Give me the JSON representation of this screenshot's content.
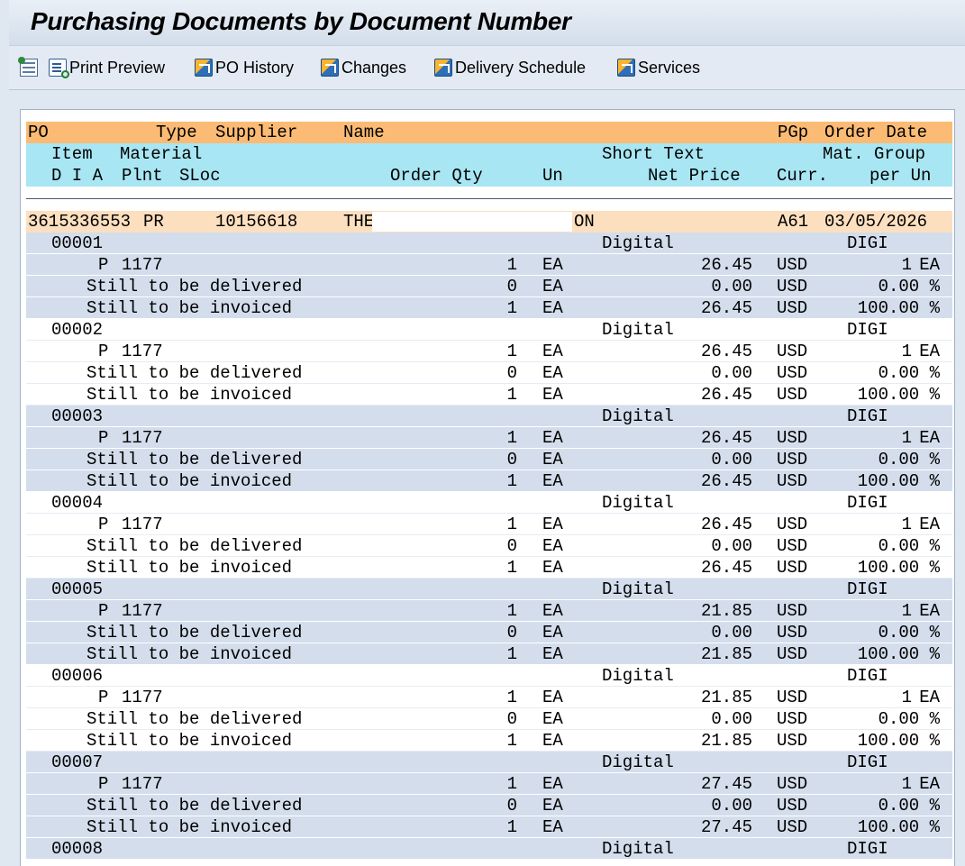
{
  "window": {
    "title": "Purchasing Documents by Document Number"
  },
  "toolbar": {
    "print_preview": "Print Preview",
    "po_history": "PO History",
    "changes": "Changes",
    "delivery_schedule": "Delivery Schedule",
    "services": "Services"
  },
  "headers": {
    "row1": {
      "po": "PO",
      "type": "Type",
      "supplier": "Supplier",
      "name": "Name",
      "pgp": "PGp",
      "order_date": "Order Date"
    },
    "row2": {
      "item": "Item",
      "material": "Material",
      "short_text": "Short Text",
      "mat_group": "Mat. Group"
    },
    "row3": {
      "dia": "D I A",
      "plnt": "Plnt",
      "sloc": "SLoc",
      "order_qty": "Order Qty",
      "un": "Un",
      "net_price": "Net Price",
      "curr": "Curr.",
      "per_un": "per Un"
    }
  },
  "document": {
    "po_number": "3615336553",
    "type": "PR",
    "supplier": "10156618",
    "name_start": "THE",
    "name_end": "ON",
    "pgp": "A61",
    "order_date": "03/05/2026"
  },
  "labels": {
    "delivered": "Still to be delivered",
    "invoiced": "Still to be invoiced"
  },
  "items": [
    {
      "item": "00001",
      "short_text": "Digital",
      "mat_group": "DIGI",
      "a": "P",
      "plant": "1177",
      "qty": "1",
      "un": "EA",
      "price": "26.45",
      "curr": "USD",
      "per": "1",
      "per_un": "EA",
      "del_qty": "0",
      "del_un": "EA",
      "del_price": "0.00",
      "del_curr": "USD",
      "del_pct": "0.00 %",
      "inv_qty": "1",
      "inv_un": "EA",
      "inv_price": "26.45",
      "inv_curr": "USD",
      "inv_pct": "100.00 %"
    },
    {
      "item": "00002",
      "short_text": "Digital",
      "mat_group": "DIGI",
      "a": "P",
      "plant": "1177",
      "qty": "1",
      "un": "EA",
      "price": "26.45",
      "curr": "USD",
      "per": "1",
      "per_un": "EA",
      "del_qty": "0",
      "del_un": "EA",
      "del_price": "0.00",
      "del_curr": "USD",
      "del_pct": "0.00 %",
      "inv_qty": "1",
      "inv_un": "EA",
      "inv_price": "26.45",
      "inv_curr": "USD",
      "inv_pct": "100.00 %"
    },
    {
      "item": "00003",
      "short_text": "Digital",
      "mat_group": "DIGI",
      "a": "P",
      "plant": "1177",
      "qty": "1",
      "un": "EA",
      "price": "26.45",
      "curr": "USD",
      "per": "1",
      "per_un": "EA",
      "del_qty": "0",
      "del_un": "EA",
      "del_price": "0.00",
      "del_curr": "USD",
      "del_pct": "0.00 %",
      "inv_qty": "1",
      "inv_un": "EA",
      "inv_price": "26.45",
      "inv_curr": "USD",
      "inv_pct": "100.00 %"
    },
    {
      "item": "00004",
      "short_text": "Digital",
      "mat_group": "DIGI",
      "a": "P",
      "plant": "1177",
      "qty": "1",
      "un": "EA",
      "price": "26.45",
      "curr": "USD",
      "per": "1",
      "per_un": "EA",
      "del_qty": "0",
      "del_un": "EA",
      "del_price": "0.00",
      "del_curr": "USD",
      "del_pct": "0.00 %",
      "inv_qty": "1",
      "inv_un": "EA",
      "inv_price": "26.45",
      "inv_curr": "USD",
      "inv_pct": "100.00 %"
    },
    {
      "item": "00005",
      "short_text": "Digital",
      "mat_group": "DIGI",
      "a": "P",
      "plant": "1177",
      "qty": "1",
      "un": "EA",
      "price": "21.85",
      "curr": "USD",
      "per": "1",
      "per_un": "EA",
      "del_qty": "0",
      "del_un": "EA",
      "del_price": "0.00",
      "del_curr": "USD",
      "del_pct": "0.00 %",
      "inv_qty": "1",
      "inv_un": "EA",
      "inv_price": "21.85",
      "inv_curr": "USD",
      "inv_pct": "100.00 %"
    },
    {
      "item": "00006",
      "short_text": "Digital",
      "mat_group": "DIGI",
      "a": "P",
      "plant": "1177",
      "qty": "1",
      "un": "EA",
      "price": "21.85",
      "curr": "USD",
      "per": "1",
      "per_un": "EA",
      "del_qty": "0",
      "del_un": "EA",
      "del_price": "0.00",
      "del_curr": "USD",
      "del_pct": "0.00 %",
      "inv_qty": "1",
      "inv_un": "EA",
      "inv_price": "21.85",
      "inv_curr": "USD",
      "inv_pct": "100.00 %"
    },
    {
      "item": "00007",
      "short_text": "Digital",
      "mat_group": "DIGI",
      "a": "P",
      "plant": "1177",
      "qty": "1",
      "un": "EA",
      "price": "27.45",
      "curr": "USD",
      "per": "1",
      "per_un": "EA",
      "del_qty": "0",
      "del_un": "EA",
      "del_price": "0.00",
      "del_curr": "USD",
      "del_pct": "0.00 %",
      "inv_qty": "1",
      "inv_un": "EA",
      "inv_price": "27.45",
      "inv_curr": "USD",
      "inv_pct": "100.00 %"
    }
  ],
  "last_item": {
    "item": "00008",
    "short_text": "Digital",
    "mat_group": "DIGI"
  }
}
